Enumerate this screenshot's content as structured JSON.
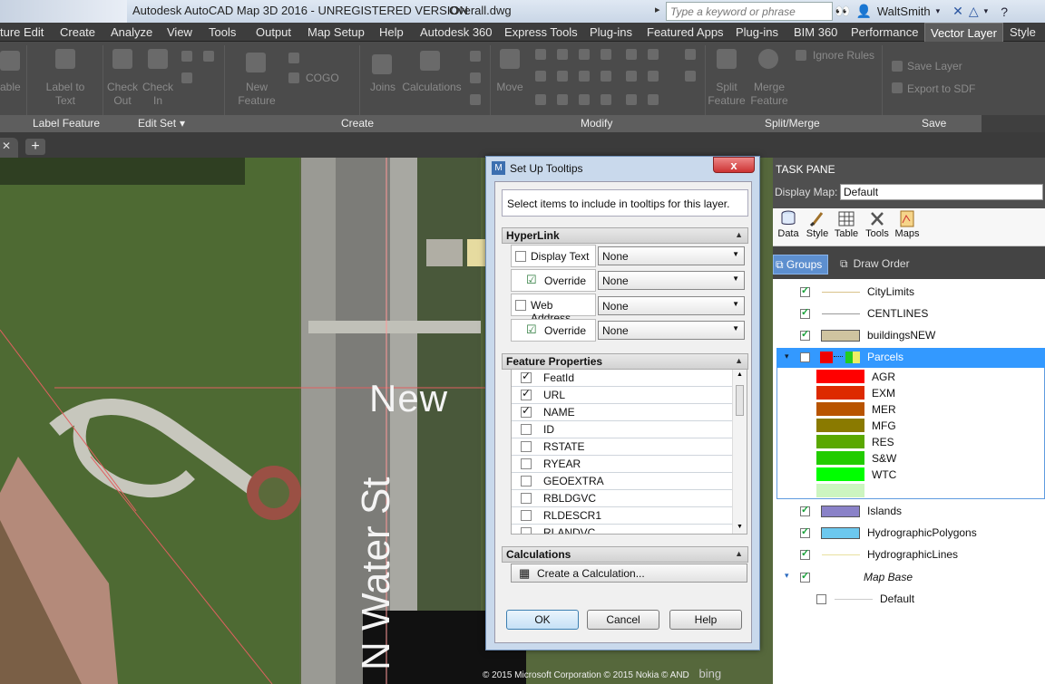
{
  "titlebar": {
    "left_fade": "ture Edit",
    "title": "Autodesk AutoCAD Map 3D 2016 - UNREGISTERED VERSION",
    "document": "Overall.dwg",
    "search_placeholder": "Type a keyword or phrase",
    "user": "WaltSmith"
  },
  "menubar": {
    "items": [
      "ture Edit",
      "Create",
      "Analyze",
      "View",
      "Tools",
      "Output",
      "Map Setup",
      "Help",
      "Autodesk 360",
      "Express Tools",
      "Plug-ins",
      "Featured Apps",
      "Plug-ins",
      "BIM 360",
      "Performance",
      "Vector Layer",
      "Style"
    ],
    "active": "Vector Layer"
  },
  "ribbon": {
    "buttons": [
      "able",
      "Label to Text",
      "Check Out",
      "Check In",
      "New Feature",
      "COGO",
      "Joins",
      "Calculations",
      "Move",
      "Split Feature",
      "Merge Feature",
      "Ignore Rules",
      "Save Layer",
      "Export to SDF"
    ],
    "panels": [
      "Label Feature",
      "Edit Set",
      "Create",
      "Modify",
      "Split/Merge",
      "Save"
    ]
  },
  "map": {
    "street_label": "N Water St",
    "street_label_2": "New",
    "credit": "© 2015 Microsoft Corporation © 2015 Nokia © AND",
    "bing": "bing"
  },
  "taskpane": {
    "title": "TASK PANE",
    "display_map_label": "Display Map:",
    "display_map_value": "Default",
    "tools": [
      "Data",
      "Style",
      "Table",
      "Tools",
      "Maps"
    ],
    "tabs": {
      "groups": "Groups",
      "draw_order": "Draw Order"
    },
    "layers": [
      {
        "name": "CityLimits",
        "checked": true
      },
      {
        "name": "CENTLINES",
        "checked": true
      },
      {
        "name": "buildingsNEW",
        "checked": true
      },
      {
        "name": "Parcels",
        "checked": false
      },
      {
        "name": "Islands",
        "checked": true
      },
      {
        "name": "HydrographicPolygons",
        "checked": true
      },
      {
        "name": "HydrographicLines",
        "checked": true
      },
      {
        "name": "Map Base",
        "checked": true
      },
      {
        "name": "Default",
        "checked": false
      }
    ],
    "parcel_themes": [
      {
        "name": "AGR",
        "color": "#ff0000"
      },
      {
        "name": "EXM",
        "color": "#dd2a00"
      },
      {
        "name": "MER",
        "color": "#b85400"
      },
      {
        "name": "MFG",
        "color": "#8a7a00"
      },
      {
        "name": "RES",
        "color": "#5aa800"
      },
      {
        "name": "S&W",
        "color": "#22cc00"
      },
      {
        "name": "WTC",
        "color": "#00ff00"
      }
    ],
    "swatch_colors": {
      "buildings": "#cfc4a0",
      "islands": "#8a82c8",
      "hydro_poly": "#6cc8ee",
      "city_line": "#d9c38a",
      "cent_line": "#999999",
      "hydro_line": "#e8e0a0",
      "selected": "#3399ff"
    }
  },
  "dialog": {
    "title": "Set Up Tooltips",
    "close": "x",
    "instruction": "Select items to include in tooltips for this layer.",
    "hyperlink_header": "HyperLink",
    "hyperlink_rows": [
      {
        "label": "Display Text",
        "value": "None"
      },
      {
        "label": "Override",
        "value": "None"
      },
      {
        "label": "Web Address",
        "value": "None"
      },
      {
        "label": "Override",
        "value": "None"
      }
    ],
    "feature_header": "Feature Properties",
    "features": [
      {
        "name": "FeatId",
        "checked": true
      },
      {
        "name": "URL",
        "checked": true
      },
      {
        "name": "NAME",
        "checked": true
      },
      {
        "name": "ID",
        "checked": false
      },
      {
        "name": "RSTATE",
        "checked": false
      },
      {
        "name": "RYEAR",
        "checked": false
      },
      {
        "name": "GEOEXTRA",
        "checked": false
      },
      {
        "name": "RBLDGVC",
        "checked": false
      },
      {
        "name": "RLDESCR1",
        "checked": false
      },
      {
        "name": "RLANDVC",
        "checked": false
      }
    ],
    "calc_header": "Calculations",
    "calc_button": "Create a Calculation...",
    "ok": "OK",
    "cancel": "Cancel",
    "help": "Help"
  }
}
